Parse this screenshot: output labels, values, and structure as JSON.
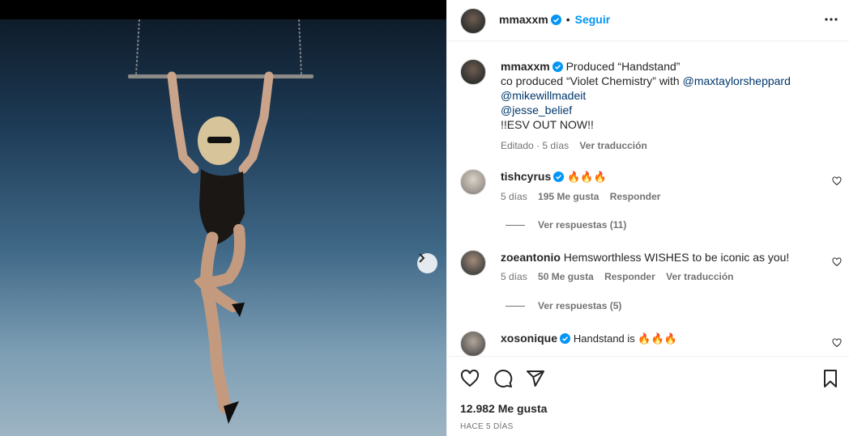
{
  "post": {
    "author": "mmaxxm",
    "follow_label": "Seguir",
    "dot": "•",
    "caption": {
      "author": "mmaxxm",
      "line1": "Produced “Handstand”",
      "line2_prefix": "co produced “Violet Chemistry” with ",
      "mention1": "@maxtaylorsheppard",
      "mention2": "@mikewillmadeit",
      "mention3": "@jesse_belief",
      "line_last": "!!ESV OUT NOW!!",
      "edited": "Editado",
      "time": "5 días",
      "translate": "Ver traducción"
    }
  },
  "comments": [
    {
      "user": "tishcyrus",
      "text": "🔥🔥🔥",
      "time": "5 días",
      "likes": "195 Me gusta",
      "reply": "Responder",
      "replies": "Ver respuestas (11)"
    },
    {
      "user": "zoeantonio",
      "text": "Hemsworthless WISHES to be iconic as you!",
      "time": "5 días",
      "likes": "50 Me gusta",
      "reply": "Responder",
      "translate": "Ver traducción",
      "replies": "Ver respuestas (5)"
    },
    {
      "user": "xosonique",
      "text": "Handstand is 🔥🔥🔥"
    }
  ],
  "footer": {
    "likes": "12.982 Me gusta",
    "date": "HACE 5 DÍAS"
  },
  "colors": {
    "accent": "#0095f6",
    "link": "#00376b",
    "verified": "#0095f6",
    "muted": "#737373"
  },
  "icons": [
    "verified-icon",
    "more-icon",
    "heart-icon",
    "comment-icon",
    "share-icon",
    "bookmark-icon",
    "chevron-right-icon"
  ]
}
